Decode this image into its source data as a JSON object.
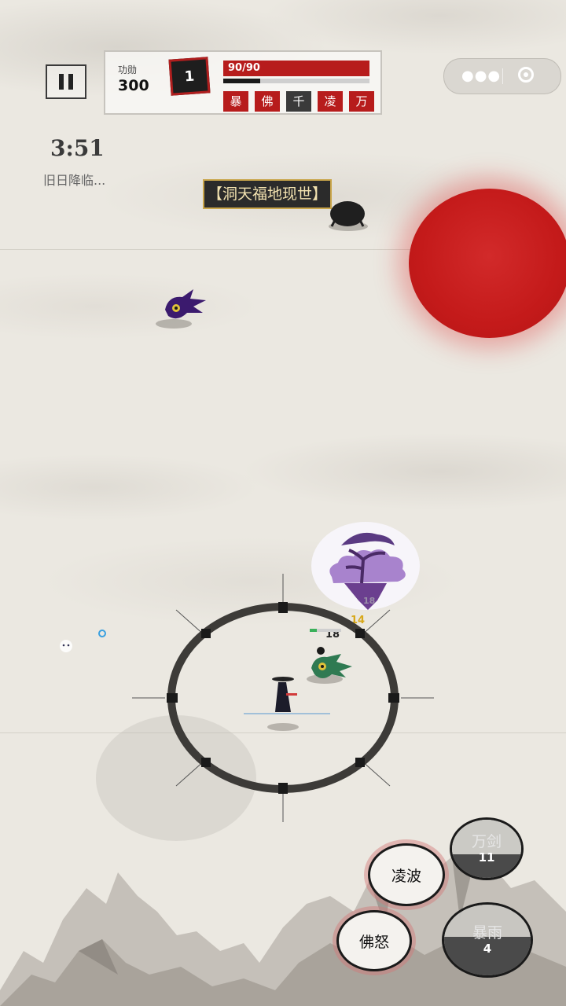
{
  "hud": {
    "merit_label": "功勋",
    "merit_value": "300",
    "level": "1",
    "hp_text": "90/90",
    "hp_fraction": 1.0,
    "xp_fraction": 0.25,
    "skill_tags": [
      {
        "label": "暴",
        "style": "red"
      },
      {
        "label": "佛",
        "style": "red"
      },
      {
        "label": "千",
        "style": "dark"
      },
      {
        "label": "凌",
        "style": "red"
      },
      {
        "label": "万",
        "style": "red"
      }
    ]
  },
  "timer": "3:51",
  "status_text": "旧日降临...",
  "event_banner": "【洞天福地现世】",
  "damage_numbers": {
    "a": "18",
    "b": "14",
    "c": "18"
  },
  "skills": {
    "lingbo": {
      "label": "凌波"
    },
    "fonu": {
      "label": "佛怒"
    },
    "wanjian": {
      "label": "万剑",
      "count": "11",
      "ready_fraction": 0.4
    },
    "baoyu": {
      "label": "暴雨",
      "count": "4",
      "ready_fraction": 0.55
    }
  },
  "colors": {
    "accent_red": "#b71c1c",
    "orb_red": "#c41a1a",
    "ink": "#1a1a1a",
    "paper": "#ebe8e1",
    "banner_gold": "#c9a54a"
  },
  "icons": {
    "pause": "pause-icon",
    "menu": "more-dots-icon",
    "close": "target-circle-icon"
  }
}
